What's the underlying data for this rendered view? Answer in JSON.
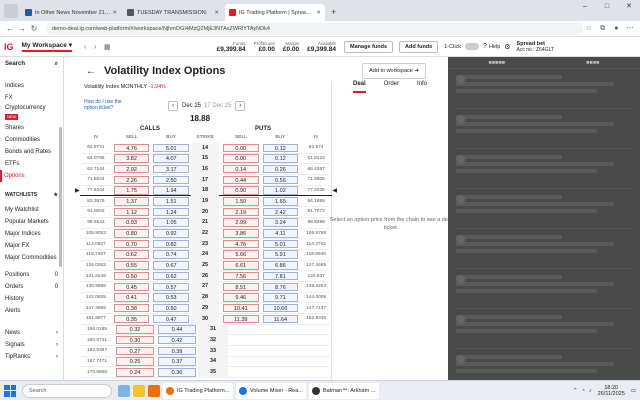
{
  "browser": {
    "tabs": [
      {
        "label": "In Other News November 21, 20",
        "color": "#2b579a",
        "active": false
      },
      {
        "label": "TUESDAY TRANSMISSION:",
        "color": "#555555",
        "active": false
      },
      {
        "label": "IG Trading Platform | Spread Be",
        "color": "#e31b23",
        "active": true
      }
    ],
    "url": "demo-deal.ig.com/web-platform/#/workspace/NjhmOGI4MzQ2MjE3NTAxZWRlYTAyNDk4"
  },
  "header": {
    "logo": "IG",
    "workspace": "My Workspace",
    "stats": [
      {
        "label": "Funds",
        "value": "£9,399.84"
      },
      {
        "label": "Profit/Loss",
        "value": "£0.00"
      },
      {
        "label": "Margin",
        "value": "£0.00"
      },
      {
        "label": "Available",
        "value": "£9,399.84"
      }
    ],
    "manage_funds": "Manage funds",
    "add_funds": "Add funds",
    "one_click": "1-Click",
    "help": "Help",
    "account_type": "Spread bet",
    "account_no": "Acc no.: Z64GLT"
  },
  "sidebar": {
    "search": "Search",
    "items": [
      {
        "label": "Indices",
        "active": false,
        "new": false
      },
      {
        "label": "FX",
        "active": false,
        "new": false
      },
      {
        "label": "Cryptocurrency",
        "active": false,
        "new": true
      },
      {
        "label": "Shares",
        "active": false,
        "new": false
      },
      {
        "label": "Commodities",
        "active": false,
        "new": false
      },
      {
        "label": "Bonds and Rates",
        "active": false,
        "new": false
      },
      {
        "label": "ETFs",
        "active": false,
        "new": false
      },
      {
        "label": "Options",
        "active": true,
        "new": false
      }
    ],
    "new_badge": "NEW",
    "watchlists_head": "WATCHLISTS",
    "watchlists": [
      "My Watchlist",
      "Popular Markets",
      "Major Indices",
      "Major FX",
      "Major Commodities"
    ],
    "positions": [
      {
        "label": "Positions",
        "count": "0"
      },
      {
        "label": "Orders",
        "count": "0"
      },
      {
        "label": "History",
        "count": ""
      },
      {
        "label": "Alerts",
        "count": ""
      }
    ],
    "bottom": [
      "News",
      "Signals",
      "TipRanks"
    ]
  },
  "main": {
    "title": "Volatility Index Options",
    "add_workspace": "Add to workspace",
    "underlying": "Volatility Index MONTHLY",
    "underlying_change": "-1.94%",
    "how_to": "How do I use the option ticket?",
    "expiry": "Dec 25",
    "expiry_alt": "17 Dec 25",
    "price": "18.88",
    "calls_label": "CALLS",
    "puts_label": "PUTS",
    "columns": {
      "iv": "IV",
      "sell": "SELL",
      "buy": "BUY",
      "strike": "STRIKE"
    }
  },
  "chain": [
    {
      "civ": "62.9731",
      "cs": "4.76",
      "cb": "5.01",
      "k": "14",
      "ps": "0.00",
      "pb": "0.12",
      "piv": "62.974"
    },
    {
      "civ": "64.0795",
      "cs": "3.82",
      "cb": "4.07",
      "k": "15",
      "ps": "0.00",
      "pb": "0.12",
      "piv": "61.8124"
    },
    {
      "civ": "62.7144",
      "cs": "2.92",
      "cb": "3.17",
      "k": "16",
      "ps": "0.14",
      "pb": "0.26",
      "piv": "65.4267"
    },
    {
      "civ": "71.5544",
      "cs": "2.26",
      "cb": "2.50",
      "k": "17",
      "ps": "0.44",
      "pb": "0.56",
      "piv": "71.5605"
    },
    {
      "civ": "77.8344",
      "cs": "1.75",
      "cb": "1.94",
      "k": "18",
      "ps": "0.90",
      "pb": "1.02",
      "piv": "77.4035"
    },
    {
      "civ": "83.3578",
      "cs": "1.37",
      "cb": "1.51",
      "k": "19",
      "ps": "1.50",
      "pb": "1.65",
      "piv": "84.1989"
    },
    {
      "civ": "91.0002",
      "cs": "1.12",
      "cb": "1.24",
      "k": "20",
      "ps": "2.19",
      "pb": "2.42",
      "piv": "91.7072"
    },
    {
      "civ": "98.5543",
      "cs": "0.93",
      "cb": "1.05",
      "k": "21",
      "ps": "2.99",
      "pb": "3.24",
      "piv": "98.8498"
    },
    {
      "civ": "105.9053",
      "cs": "0.80",
      "cb": "0.92",
      "k": "22",
      "ps": "3.86",
      "pb": "4.11",
      "piv": "106.9769"
    },
    {
      "civ": "113.0827",
      "cs": "0.70",
      "cb": "0.82",
      "k": "23",
      "ps": "4.76",
      "pb": "5.01",
      "piv": "114.3762"
    },
    {
      "civ": "119.7557",
      "cs": "0.62",
      "cb": "0.74",
      "k": "24",
      "ps": "5.66",
      "pb": "5.91",
      "piv": "119.8945"
    },
    {
      "civ": "126.0262",
      "cs": "0.55",
      "cb": "0.67",
      "k": "25",
      "ps": "6.61",
      "pb": "6.86",
      "piv": "127.4665"
    },
    {
      "civ": "131.8246",
      "cs": "0.50",
      "cb": "0.62",
      "k": "26",
      "ps": "7.56",
      "pb": "7.81",
      "piv": "133.937"
    },
    {
      "civ": "136.9856",
      "cs": "0.45",
      "cb": "0.57",
      "k": "27",
      "ps": "8.51",
      "pb": "8.76",
      "piv": "139.4254"
    },
    {
      "civ": "142.0935",
      "cs": "0.41",
      "cb": "0.53",
      "k": "28",
      "ps": "9.46",
      "pb": "9.71",
      "piv": "144.0009"
    },
    {
      "civ": "147.3665",
      "cs": "0.38",
      "cb": "0.50",
      "k": "29",
      "ps": "10.41",
      "pb": "10.66",
      "piv": "147.7137"
    },
    {
      "civ": "151.9977",
      "cs": "0.35",
      "cb": "0.47",
      "k": "30",
      "ps": "11.39",
      "pb": "11.64",
      "piv": "152.9345"
    },
    {
      "civ": "156.0185",
      "cs": "0.32",
      "cb": "0.44",
      "k": "31",
      "ps": "",
      "pb": "",
      "piv": ""
    },
    {
      "civ": "160.5741",
      "cs": "0.30",
      "cb": "0.42",
      "k": "32",
      "ps": "",
      "pb": "",
      "piv": ""
    },
    {
      "civ": "162.9387",
      "cs": "0.27",
      "cb": "0.39",
      "k": "33",
      "ps": "",
      "pb": "",
      "piv": ""
    },
    {
      "civ": "167.7471",
      "cs": "0.25",
      "cb": "0.37",
      "k": "34",
      "ps": "",
      "pb": "",
      "piv": ""
    },
    {
      "civ": "170.9908",
      "cs": "0.24",
      "cb": "0.36",
      "k": "35",
      "ps": "",
      "pb": "",
      "piv": ""
    }
  ],
  "ticket": {
    "tabs": [
      "Deal",
      "Order",
      "Info"
    ],
    "message": "Select an option price from the chain to see a deal ticket."
  },
  "taskbar": {
    "search": "Search",
    "apps": [
      {
        "label": "IG Trading Platform...",
        "color": "#e8710a"
      },
      {
        "label": "Volume Mixer - Rea...",
        "color": "#1a73e8"
      },
      {
        "label": "Batman™: Arkham ...",
        "color": "#333333"
      }
    ],
    "time": "18:20",
    "date": "26/11/2025"
  }
}
